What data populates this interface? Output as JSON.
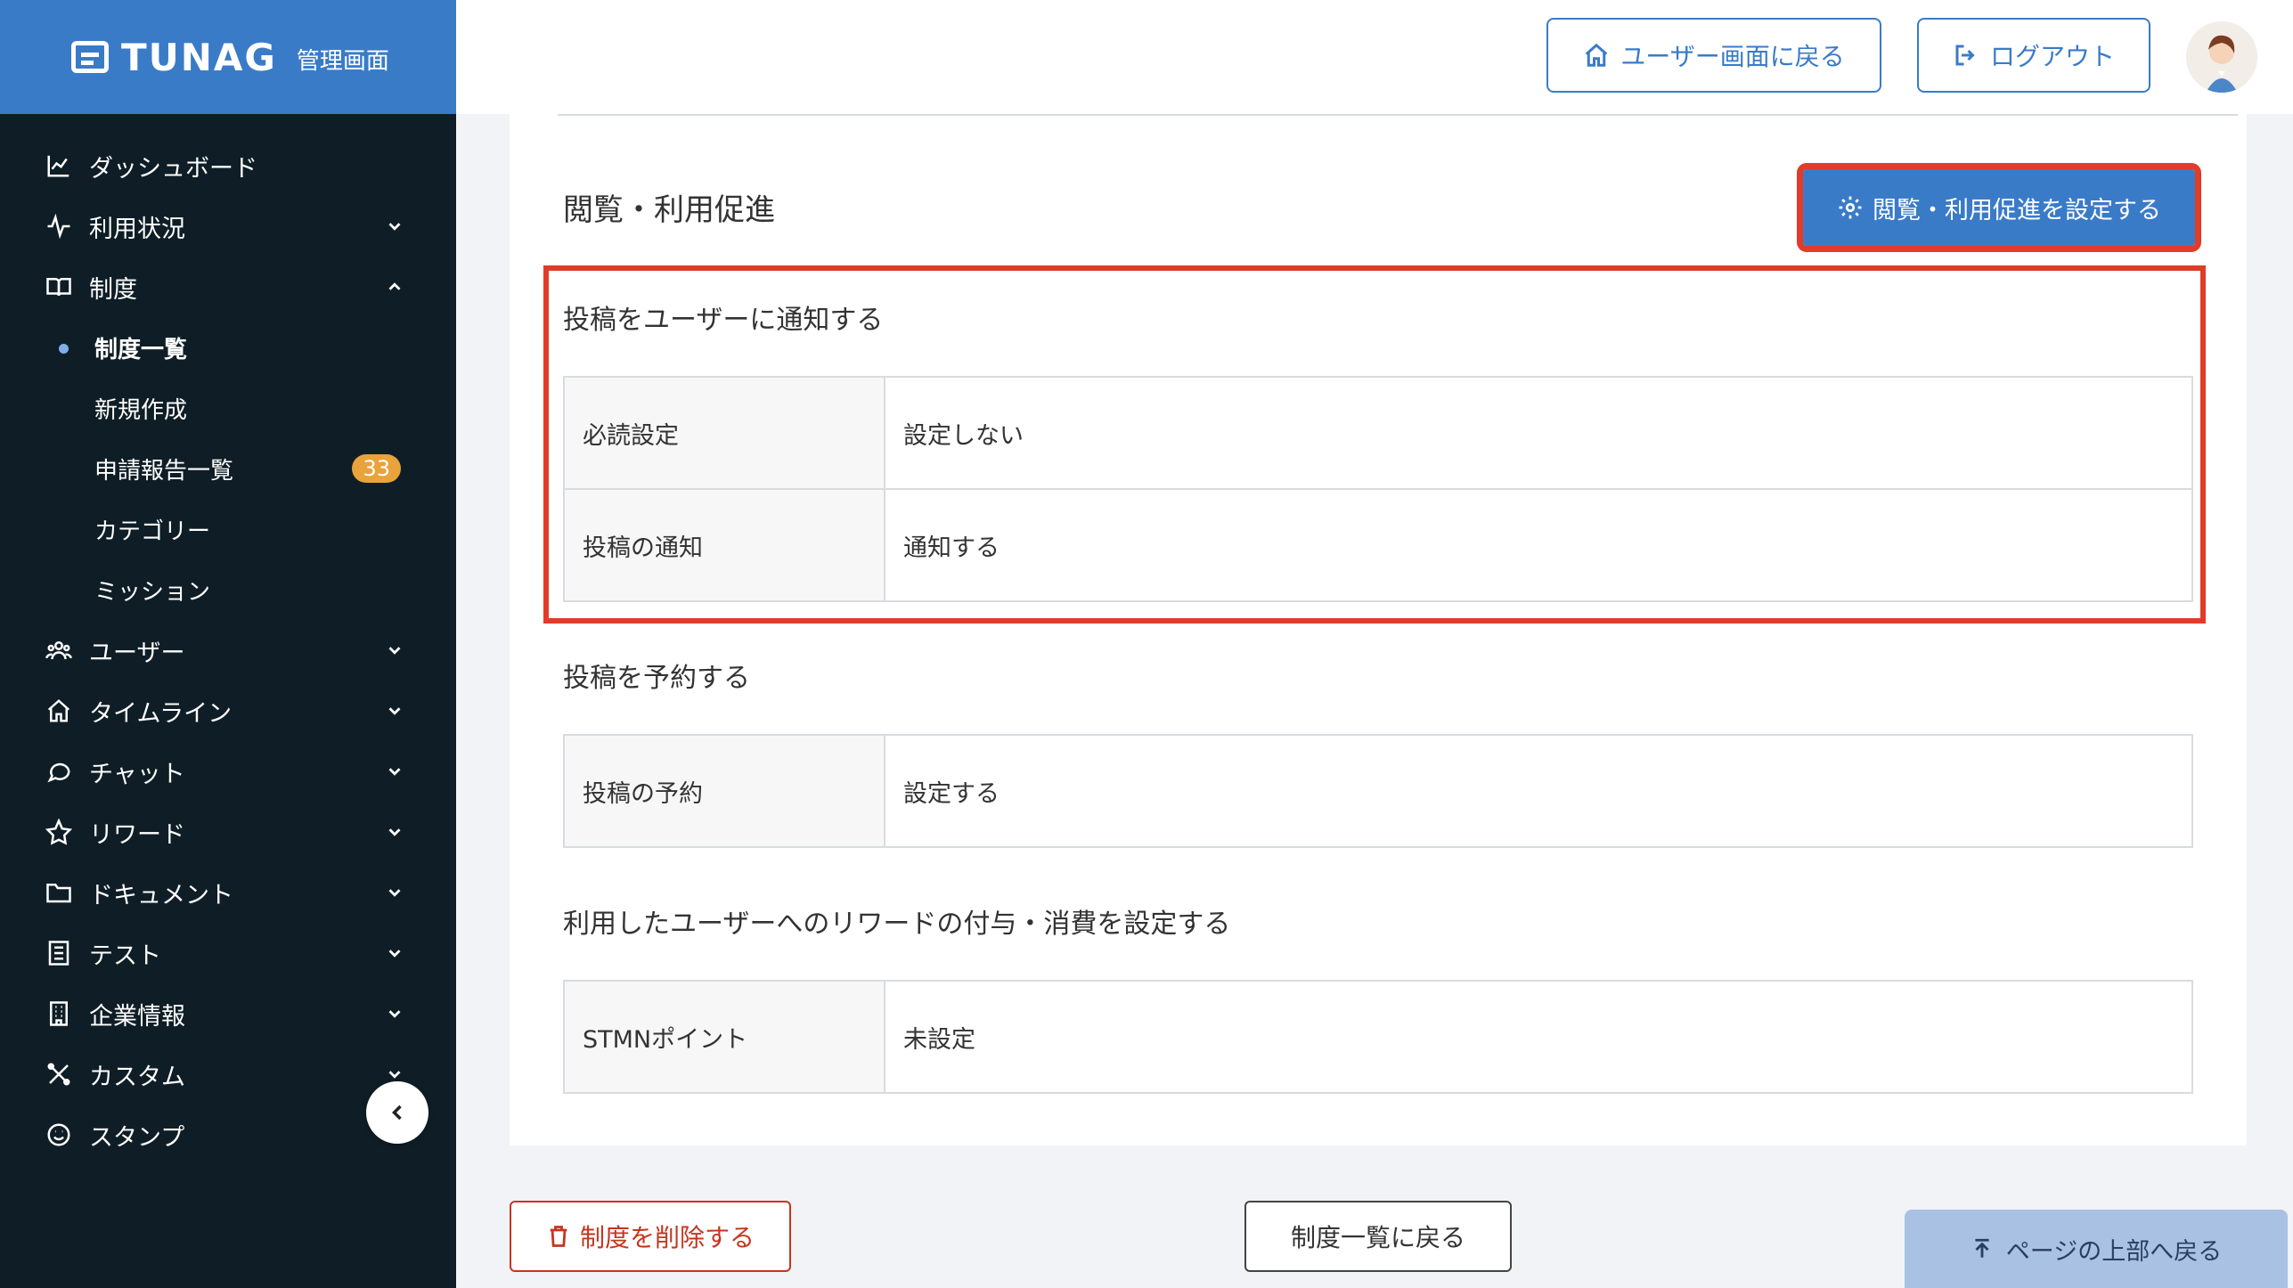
{
  "brand": {
    "logo_text": "TUNAG",
    "subtitle": "管理画面"
  },
  "header": {
    "user_screen_button": "ユーザー画面に戻る",
    "logout_button": "ログアウト"
  },
  "sidebar": {
    "items": [
      {
        "label": "ダッシュボード",
        "icon": "chart-icon"
      },
      {
        "label": "利用状況",
        "icon": "activity-icon"
      },
      {
        "label": "制度",
        "icon": "book-icon"
      },
      {
        "label": "ユーザー",
        "icon": "users-icon"
      },
      {
        "label": "タイムライン",
        "icon": "home-icon"
      },
      {
        "label": "チャット",
        "icon": "chat-icon"
      },
      {
        "label": "リワード",
        "icon": "star-icon"
      },
      {
        "label": "ドキュメント",
        "icon": "folder-icon"
      },
      {
        "label": "テスト",
        "icon": "checklist-icon"
      },
      {
        "label": "企業情報",
        "icon": "building-icon"
      },
      {
        "label": "カスタム",
        "icon": "tools-icon"
      },
      {
        "label": "スタンプ",
        "icon": "smile-icon"
      }
    ],
    "sub_items": [
      {
        "label": "制度一覧"
      },
      {
        "label": "新規作成"
      },
      {
        "label": "申請報告一覧",
        "badge": "33"
      },
      {
        "label": "カテゴリー"
      },
      {
        "label": "ミッション"
      }
    ]
  },
  "main": {
    "section_title": "閲覧・利用促進",
    "settings_button": "閲覧・利用促進を設定する",
    "notify": {
      "title": "投稿をユーザーに通知する",
      "rows": [
        {
          "key": "必読設定",
          "value": "設定しない"
        },
        {
          "key": "投稿の通知",
          "value": "通知する"
        }
      ]
    },
    "reserve": {
      "title": "投稿を予約する",
      "rows": [
        {
          "key": "投稿の予約",
          "value": "設定する"
        }
      ]
    },
    "reward": {
      "title": "利用したユーザーへのリワードの付与・消費を設定する",
      "rows": [
        {
          "key": "STMNポイント",
          "value": "未設定"
        }
      ]
    }
  },
  "footer": {
    "delete_button": "制度を削除する",
    "back_button": "制度一覧に戻る",
    "top_button": "ページの上部へ戻る"
  },
  "colors": {
    "accent": "#3a7bc8",
    "sidebar_bg": "#0f1e26",
    "highlight": "#e03c28",
    "danger": "#c6351f",
    "badge": "#e8a33b"
  }
}
